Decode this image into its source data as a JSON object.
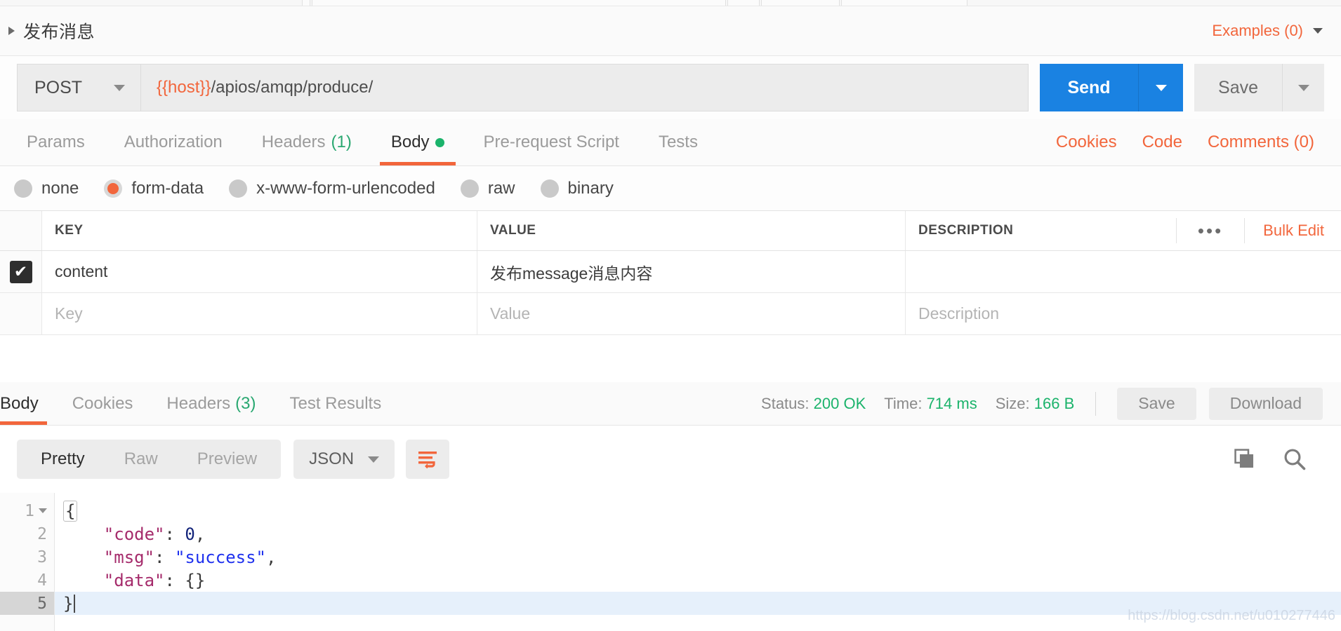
{
  "request": {
    "title": "发布消息",
    "collapse_icon": "triangle-right-icon",
    "examples_label": "Examples (0)",
    "examples_caret": "chevron-down-icon",
    "method": "POST",
    "method_caret": "chevron-down-icon",
    "url_variable": "{{host}}",
    "url_path": "/apios/amqp/produce/",
    "send_label": "Send",
    "send_caret": "chevron-down-icon",
    "save_label": "Save",
    "save_caret": "chevron-down-icon",
    "accent_orange": "#f2663c",
    "accent_blue": "#1a82e2",
    "accent_green": "#1bb36b"
  },
  "request_tabs": {
    "items": [
      {
        "label": "Params",
        "count": "",
        "active": false,
        "dot": false
      },
      {
        "label": "Authorization",
        "count": "",
        "active": false,
        "dot": false
      },
      {
        "label": "Headers",
        "count": "(1)",
        "active": false,
        "dot": false
      },
      {
        "label": "Body",
        "count": "",
        "active": true,
        "dot": true
      },
      {
        "label": "Pre-request Script",
        "count": "",
        "active": false,
        "dot": false
      },
      {
        "label": "Tests",
        "count": "",
        "active": false,
        "dot": false
      }
    ],
    "links": [
      "Cookies",
      "Code",
      "Comments (0)"
    ]
  },
  "body_type": {
    "options": [
      {
        "label": "none",
        "selected": false
      },
      {
        "label": "form-data",
        "selected": true
      },
      {
        "label": "x-www-form-urlencoded",
        "selected": false
      },
      {
        "label": "raw",
        "selected": false
      },
      {
        "label": "binary",
        "selected": false
      }
    ]
  },
  "kv_table": {
    "headers": [
      "KEY",
      "VALUE",
      "DESCRIPTION"
    ],
    "more_icon": "•••",
    "bulk_edit_label": "Bulk Edit",
    "rows": [
      {
        "checked": true,
        "check_mark": "✔",
        "key": "content",
        "value": "发布message消息内容",
        "description": ""
      }
    ],
    "placeholders": {
      "key": "Key",
      "value": "Value",
      "description": "Description"
    }
  },
  "response": {
    "tabs": [
      {
        "label": "Body",
        "count": "",
        "active": true
      },
      {
        "label": "Cookies",
        "count": "",
        "active": false
      },
      {
        "label": "Headers",
        "count": "(3)",
        "active": false
      },
      {
        "label": "Test Results",
        "count": "",
        "active": false
      }
    ],
    "status_label": "Status:",
    "status_value": "200 OK",
    "time_label": "Time:",
    "time_value": "714 ms",
    "size_label": "Size:",
    "size_value": "166 B",
    "save_label": "Save",
    "download_label": "Download",
    "formats": [
      {
        "label": "Pretty",
        "active": true
      },
      {
        "label": "Raw",
        "active": false
      },
      {
        "label": "Preview",
        "active": false
      }
    ],
    "language": "JSON",
    "language_caret": "chevron-down-icon",
    "wrap_icon": "word-wrap-icon",
    "copy_icon": "copy-icon",
    "search_icon": "search-icon",
    "code_lines": [
      {
        "num": "1",
        "foldable": true,
        "current": false,
        "tokens": [
          {
            "t": "pun",
            "v": "{",
            "boxed": true
          }
        ]
      },
      {
        "num": "2",
        "foldable": false,
        "current": false,
        "tokens": [
          {
            "t": "pun",
            "v": "    "
          },
          {
            "t": "key",
            "v": "\"code\""
          },
          {
            "t": "pun",
            "v": ": "
          },
          {
            "t": "num",
            "v": "0"
          },
          {
            "t": "pun",
            "v": ","
          }
        ]
      },
      {
        "num": "3",
        "foldable": false,
        "current": false,
        "tokens": [
          {
            "t": "pun",
            "v": "    "
          },
          {
            "t": "key",
            "v": "\"msg\""
          },
          {
            "t": "pun",
            "v": ": "
          },
          {
            "t": "str",
            "v": "\"success\""
          },
          {
            "t": "pun",
            "v": ","
          }
        ]
      },
      {
        "num": "4",
        "foldable": false,
        "current": false,
        "tokens": [
          {
            "t": "pun",
            "v": "    "
          },
          {
            "t": "key",
            "v": "\"data\""
          },
          {
            "t": "pun",
            "v": ": "
          },
          {
            "t": "pun",
            "v": "{}"
          }
        ]
      },
      {
        "num": "5",
        "foldable": false,
        "current": true,
        "tokens": [
          {
            "t": "pun",
            "v": "}"
          },
          {
            "t": "caret",
            "v": ""
          }
        ]
      }
    ]
  },
  "watermark": "https://blog.csdn.net/u010277446"
}
